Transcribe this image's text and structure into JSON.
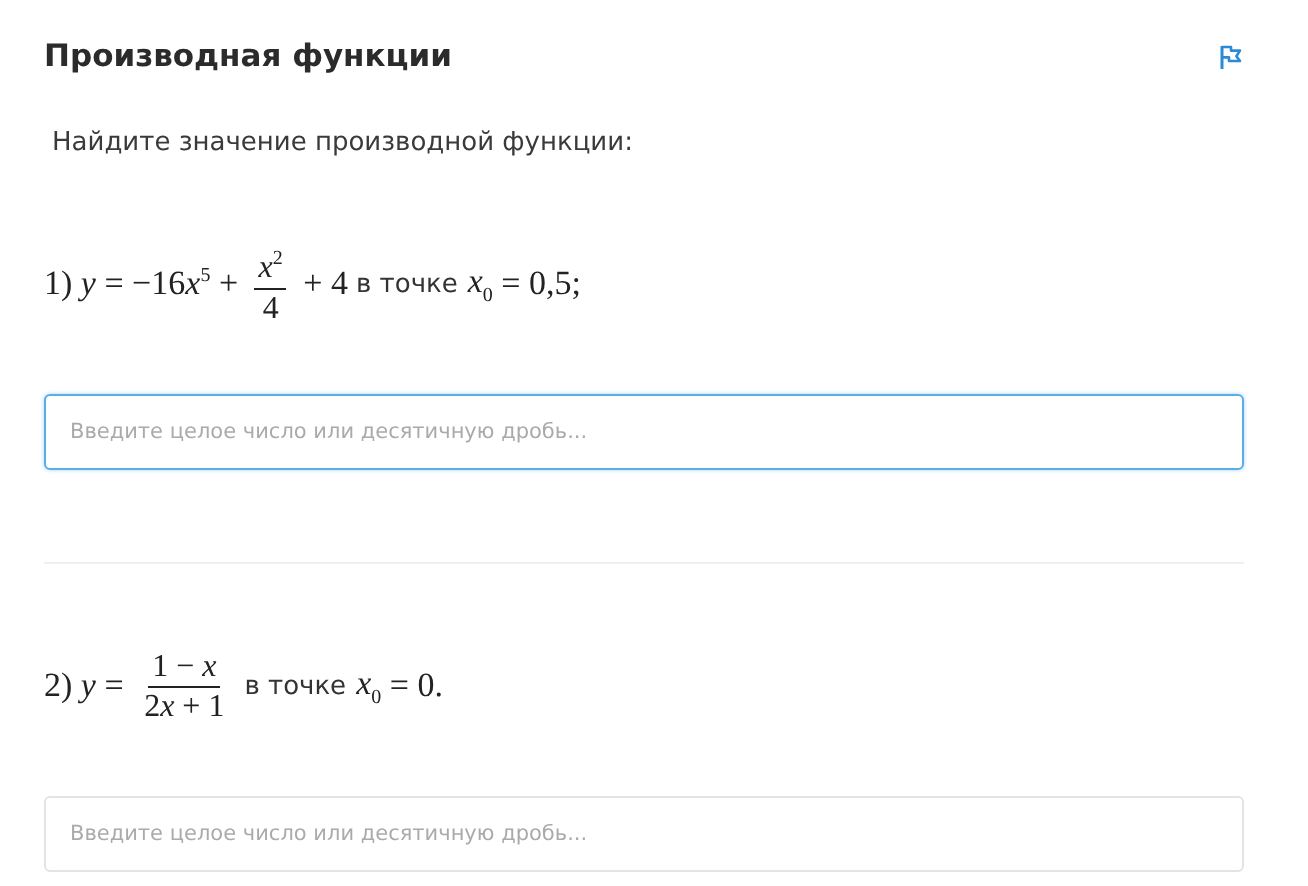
{
  "header": {
    "title": "Производная функции"
  },
  "instruction": "Найдите значение производной функции:",
  "problems": [
    {
      "parts": [
        {
          "kind": "math",
          "text": "1) "
        },
        {
          "kind": "var",
          "text": "y"
        },
        {
          "kind": "math",
          "text": " = −16"
        },
        {
          "kind": "var",
          "text": "x",
          "sup": "5"
        },
        {
          "kind": "math",
          "text": " + "
        },
        {
          "kind": "frac",
          "num": [
            {
              "kind": "var",
              "text": "x",
              "sup": "2"
            }
          ],
          "den": [
            {
              "kind": "math",
              "text": "4"
            }
          ]
        },
        {
          "kind": "math",
          "text": " + 4"
        },
        {
          "kind": "text",
          "text": "в точке"
        },
        {
          "kind": "var",
          "text": "x",
          "sub": "0"
        },
        {
          "kind": "math",
          "text": " = 0,5;"
        }
      ],
      "answer": {
        "placeholder": "Введите целое число или десятичную дробь...",
        "focused": true
      }
    },
    {
      "parts": [
        {
          "kind": "math",
          "text": "2) "
        },
        {
          "kind": "var",
          "text": "y"
        },
        {
          "kind": "math",
          "text": " = "
        },
        {
          "kind": "frac",
          "num": [
            {
              "kind": "math",
              "text": "1 − "
            },
            {
              "kind": "var",
              "text": "x"
            }
          ],
          "den": [
            {
              "kind": "math",
              "text": "2"
            },
            {
              "kind": "var",
              "text": "x"
            },
            {
              "kind": "math",
              "text": " + 1"
            }
          ]
        },
        {
          "kind": "text",
          "text": "в точке"
        },
        {
          "kind": "var",
          "text": "x",
          "sub": "0"
        },
        {
          "kind": "math",
          "text": " = 0."
        }
      ],
      "answer": {
        "placeholder": "Введите целое число или десятичную дробь...",
        "focused": false
      }
    }
  ]
}
